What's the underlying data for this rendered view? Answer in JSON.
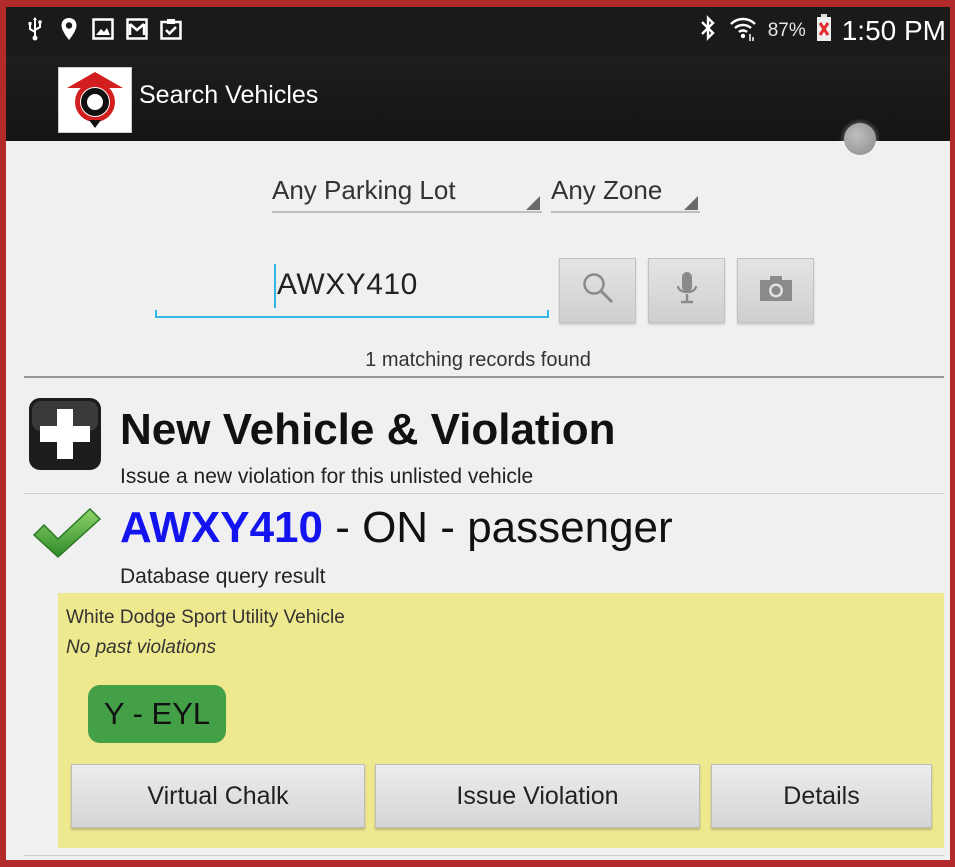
{
  "status_bar": {
    "icons": [
      "usb-icon",
      "location-icon",
      "gallery-icon",
      "gmail-icon",
      "clipboard-icon"
    ],
    "battery_percent": "87%",
    "time": "1:50 PM"
  },
  "app_bar": {
    "title": "Search Vehicles"
  },
  "filters": {
    "parking_lot": "Any Parking Lot",
    "zone": "Any Zone"
  },
  "search": {
    "value": "AWXY410"
  },
  "results_count_text": "1 matching records found",
  "new_vehicle": {
    "title": "New Vehicle & Violation",
    "subtitle": "Issue a new violation for this unlisted vehicle"
  },
  "result": {
    "plate": "AWXY410",
    "details": " - ON - passenger",
    "subtitle": "Database query result",
    "description": "White Dodge Sport Utility Vehicle",
    "past_violations": "No past violations",
    "zone_badge": "Y - EYL",
    "buttons": {
      "virtual_chalk": "Virtual Chalk",
      "issue_violation": "Issue Violation",
      "details": "Details"
    }
  },
  "colors": {
    "plate": "#1414f0",
    "panel": "#eee88f",
    "badge": "#43a047",
    "accent": "#33b5e5"
  }
}
